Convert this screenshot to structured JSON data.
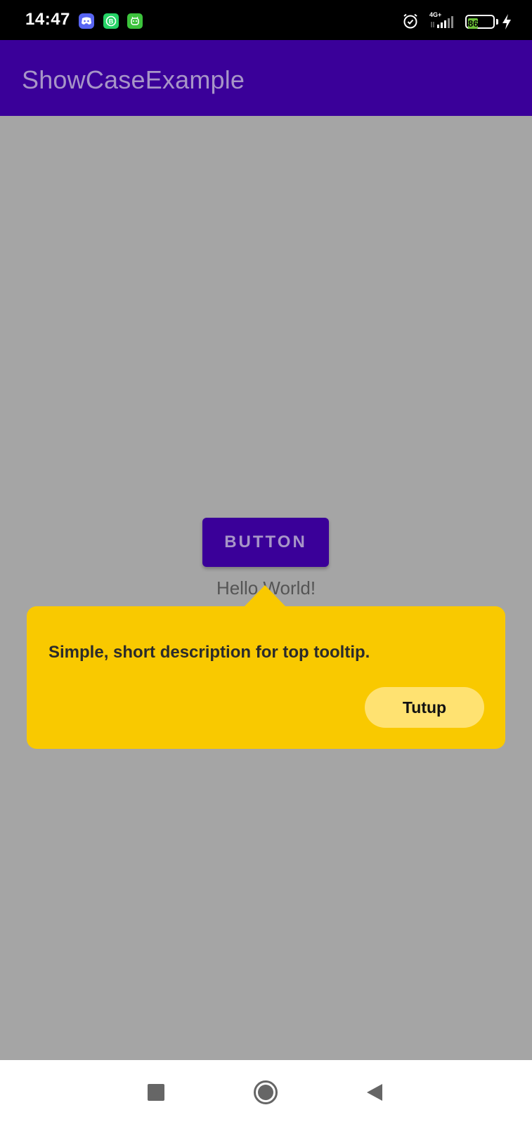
{
  "status_bar": {
    "time": "14:47",
    "network_label": "4G+",
    "battery_level": "86",
    "icons": [
      "discord-icon",
      "whatsapp-business-icon",
      "android-icon",
      "alarm-icon",
      "signal-icon",
      "battery-icon",
      "charging-bolt-icon"
    ]
  },
  "app_bar": {
    "title": "ShowCaseExample"
  },
  "content": {
    "button_label": "BUTTON",
    "hello_text": "Hello World!"
  },
  "tooltip": {
    "description": "Simple, short description for top tooltip.",
    "close_label": "Tutup"
  },
  "nav_bar": {
    "icons": [
      "recents-icon",
      "home-icon",
      "back-icon"
    ]
  },
  "colors": {
    "primary": "#3a0099",
    "overlay": "#a5a5a5",
    "tooltip_bg": "#f9c900",
    "tooltip_button_bg": "#ffe271"
  }
}
